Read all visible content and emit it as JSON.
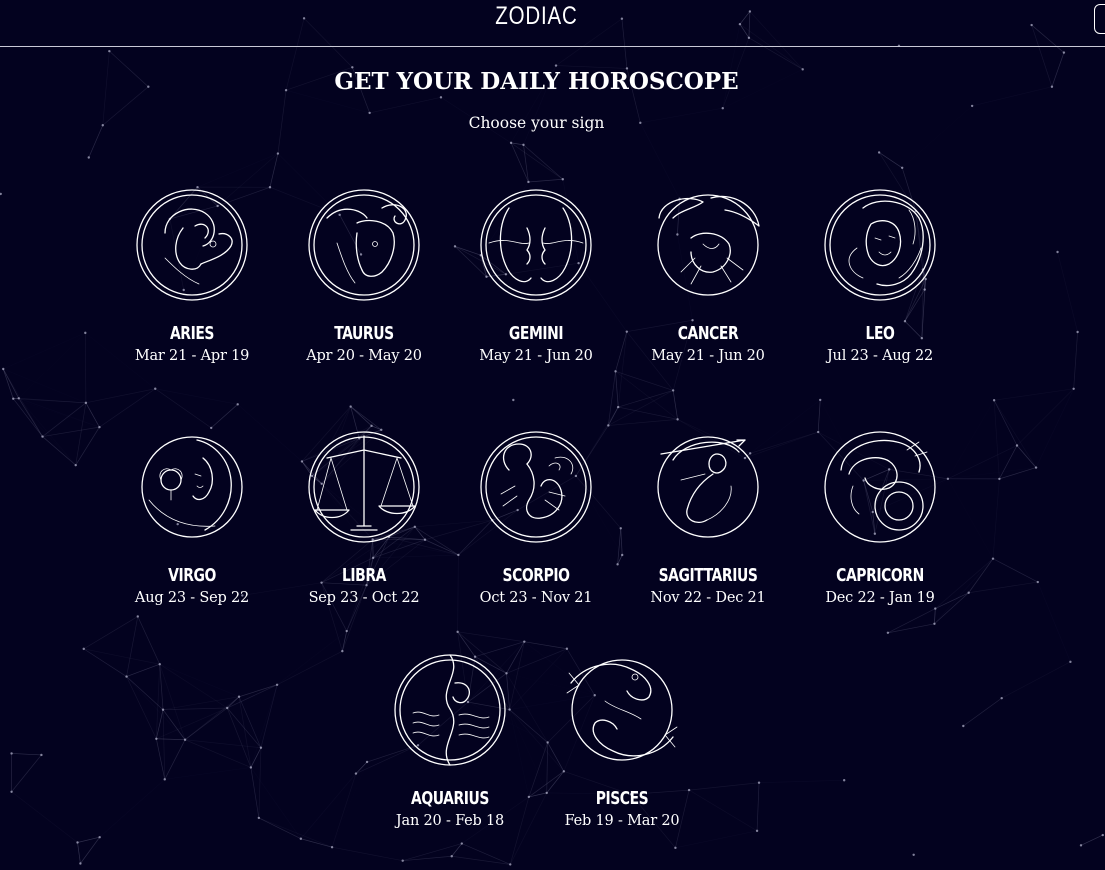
{
  "header": {
    "brand": "ZODIAC"
  },
  "page": {
    "title": "GET YOUR DAILY HOROSCOPE",
    "subtitle": "Choose your sign"
  },
  "signs": [
    {
      "name": "ARIES",
      "dates": "Mar 21 - Apr 19",
      "icon": "ram-icon"
    },
    {
      "name": "TAURUS",
      "dates": "Apr 20 - May 20",
      "icon": "bull-icon"
    },
    {
      "name": "GEMINI",
      "dates": "May 21 - Jun 20",
      "icon": "twins-icon"
    },
    {
      "name": "CANCER",
      "dates": "May 21 - Jun 20",
      "icon": "crab-icon"
    },
    {
      "name": "LEO",
      "dates": "Jul 23 - Aug 22",
      "icon": "lion-icon"
    },
    {
      "name": "VIRGO",
      "dates": "Aug 23 - Sep 22",
      "icon": "maiden-icon"
    },
    {
      "name": "LIBRA",
      "dates": "Sep 23 - Oct 22",
      "icon": "scales-icon"
    },
    {
      "name": "SCORPIO",
      "dates": "Oct 23 - Nov 21",
      "icon": "scorpion-icon"
    },
    {
      "name": "SAGITTARIUS",
      "dates": "Nov 22 - Dec 21",
      "icon": "archer-icon"
    },
    {
      "name": "CAPRICORN",
      "dates": "Dec 22 - Jan 19",
      "icon": "goat-icon"
    },
    {
      "name": "AQUARIUS",
      "dates": "Jan 20 - Feb 18",
      "icon": "water-bearer-icon"
    },
    {
      "name": "PISCES",
      "dates": "Feb 19 - Mar 20",
      "icon": "fish-icon"
    }
  ],
  "colors": {
    "background": "#03021f",
    "foreground": "#ffffff",
    "network_lines": "#8a8aa8"
  }
}
